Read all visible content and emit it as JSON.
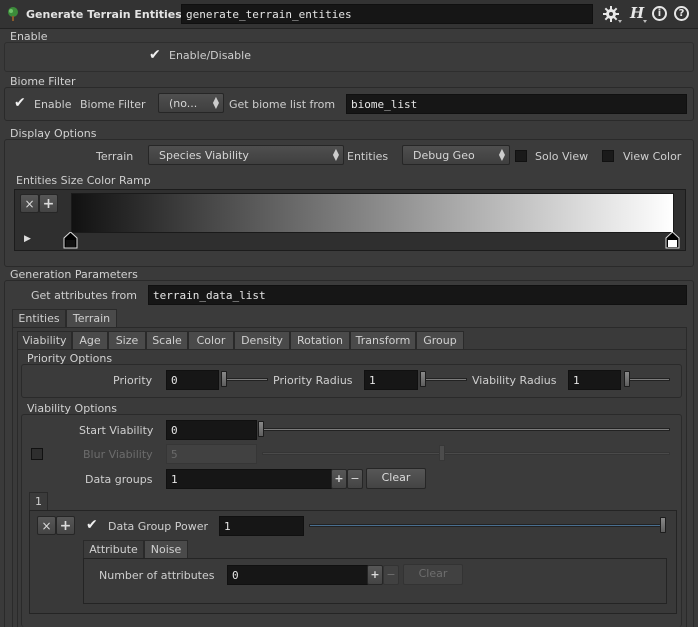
{
  "header": {
    "node_type": "Generate Terrain Entities",
    "node_name": "generate_terrain_entities",
    "icons": [
      "terrain-node-icon",
      "gear-icon",
      "houdini-help-icon",
      "info-icon",
      "help-icon"
    ],
    "help_glyph": "?",
    "info_glyph": "i",
    "h_glyph": "H"
  },
  "enable": {
    "section": "Enable",
    "checkbox_label": "Enable/Disable",
    "checked": true
  },
  "biome_filter": {
    "section": "Biome Filter",
    "enable_label": "Enable",
    "filter_label": "Biome Filter",
    "filter_value": "(no...",
    "get_list_label": "Get biome list from",
    "list_value": "biome_list"
  },
  "display": {
    "section": "Display Options",
    "terrain_label": "Terrain",
    "terrain_value": "Species Viability",
    "entities_label": "Entities",
    "entities_value": "Debug Geo",
    "solo_view_label": "Solo View",
    "view_color_label": "View Color",
    "ramp_label": "Entities Size Color Ramp",
    "ramp_from": "#111111",
    "ramp_to": "#ffffff"
  },
  "generation": {
    "section": "Generation Parameters",
    "attr_label": "Get attributes from",
    "attr_value": "terrain_data_list",
    "outer_tabs": [
      "Entities",
      "Terrain"
    ],
    "inner_tabs": [
      "Viability",
      "Age",
      "Size",
      "Scale",
      "Color",
      "Density",
      "Rotation",
      "Transform",
      "Group"
    ]
  },
  "priority": {
    "section": "Priority Options",
    "priority_label": "Priority",
    "priority_value": "0",
    "radius_label": "Priority Radius",
    "radius_value": "1",
    "viability_radius_label": "Viability Radius",
    "viability_radius_value": "1"
  },
  "viability": {
    "section": "Viability Options",
    "start_label": "Start Viability",
    "start_value": "0",
    "blur_label": "Blur Viability",
    "blur_value": "5",
    "groups_label": "Data groups",
    "groups_value": "1",
    "plus": "+",
    "minus": "−",
    "clear": "Clear",
    "group_tab": "1",
    "power_label": "Data Group Power",
    "power_value": "1",
    "sub_tabs": [
      "Attribute",
      "Noise"
    ],
    "num_attr_label": "Number of attributes",
    "num_attr_value": "0"
  }
}
